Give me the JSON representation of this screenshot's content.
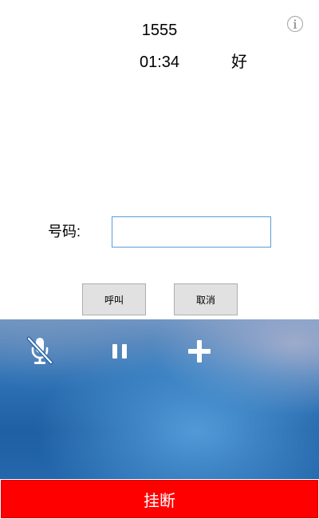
{
  "call": {
    "number": "1555",
    "timer": "01:34",
    "status": "好"
  },
  "info": {
    "icon": "info-icon"
  },
  "dial": {
    "label": "号码:",
    "value": "",
    "call_button": "呼叫",
    "cancel_button": "取消"
  },
  "controls": [
    {
      "icon": "microphone-muted-icon"
    },
    {
      "icon": "pause-icon"
    },
    {
      "icon": "plus-icon"
    }
  ],
  "hangup": {
    "label": "挂断",
    "color": "#ff0000"
  },
  "colors": {
    "panel_blue": "#2f73b6",
    "input_border": "#5b9bd5"
  }
}
